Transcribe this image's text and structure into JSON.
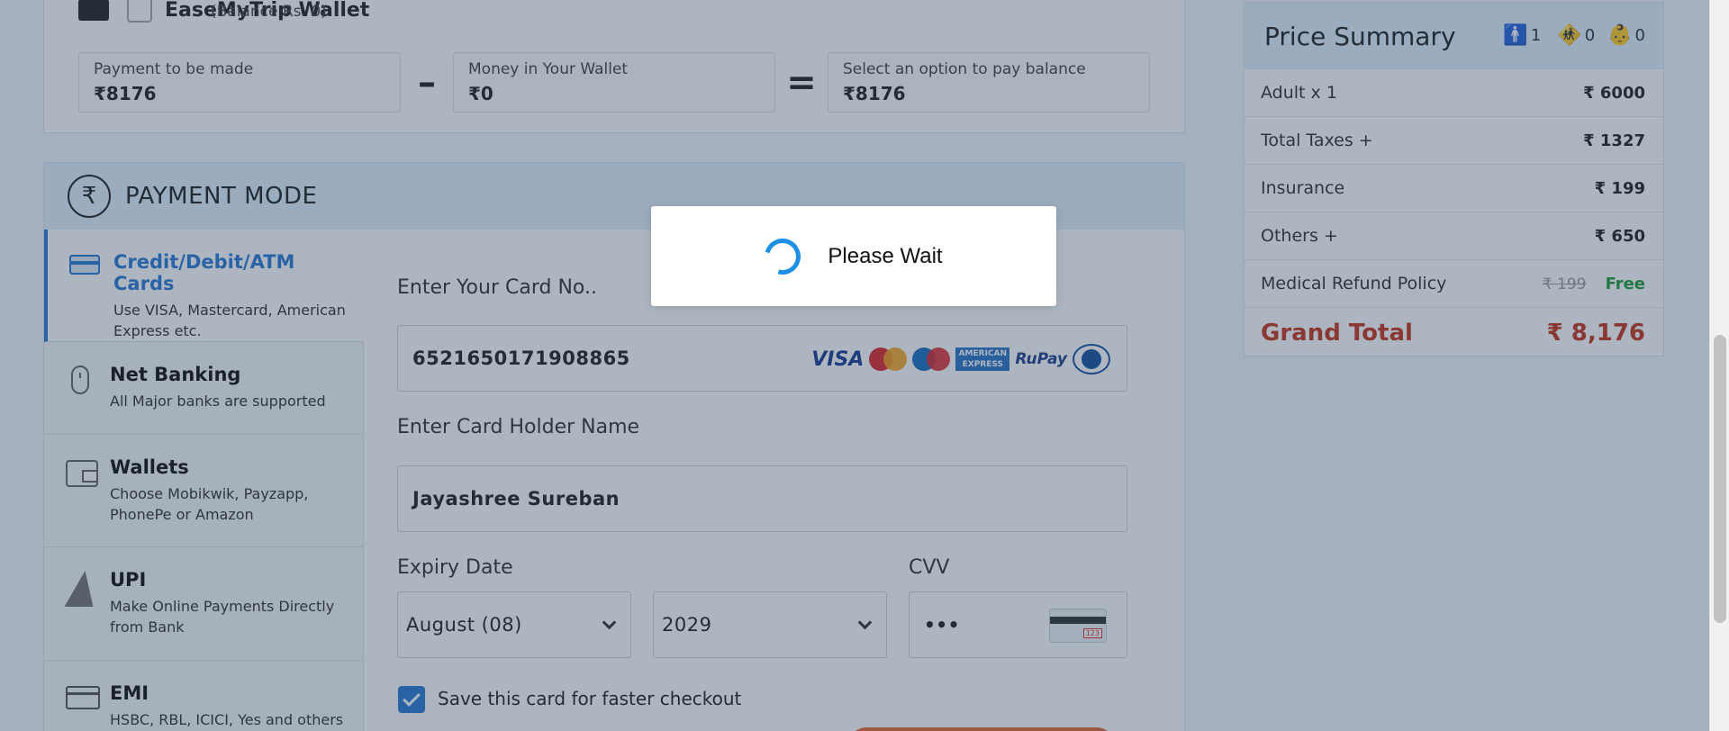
{
  "wallet": {
    "name": "EaseMyTrip Wallet",
    "balance": "(Balance Rs. 0)",
    "calc": [
      {
        "label": "Payment to be made",
        "value": "₹8176"
      },
      {
        "label": "Money in Your Wallet",
        "value": "₹0"
      },
      {
        "label": "Select an option to pay balance",
        "value": "₹8176"
      }
    ],
    "minus": "–",
    "equals": "="
  },
  "payment": {
    "title": "PAYMENT MODE",
    "currency_symbol": "₹",
    "modes": [
      {
        "title": "Credit/Debit/ATM Cards",
        "desc": "Use VISA, Mastercard, American Express etc.",
        "icon": "credit-card-icon",
        "active": true
      },
      {
        "title": "Net Banking",
        "desc": "All Major banks are supported",
        "icon": "mouse-icon",
        "active": false
      },
      {
        "title": "Wallets",
        "desc": "Choose Mobikwik, Payzapp, PhonePe or Amazon",
        "icon": "wallet-icon",
        "active": false
      },
      {
        "title": "UPI",
        "desc": "Make Online Payments Directly from Bank",
        "icon": "upi-icon",
        "active": false
      },
      {
        "title": "EMI",
        "desc": "HSBC, RBL, ICICI, Yes and others",
        "icon": "emi-card-icon",
        "active": false
      }
    ]
  },
  "form": {
    "card_label": "Enter Your Card No..",
    "card_number": "6521650171908865",
    "card_brands": {
      "visa": "VISA",
      "amex": "AMERICAN EXPRESS",
      "rupay": "RuPay"
    },
    "holder_label": "Enter Card Holder Name",
    "holder_name": "Jayashree Sureban",
    "expiry_label": "Expiry Date",
    "expiry_month": "August (08)",
    "expiry_year": "2029",
    "cvv_label": "CVV",
    "cvv_value": "•••",
    "save_card_label": "Save this card for faster checkout",
    "save_card_checked": true
  },
  "summary": {
    "title": "Price Summary",
    "pax": {
      "adults": "1",
      "children": "0",
      "infants": "0"
    },
    "rows": [
      {
        "label": "Adult x 1",
        "value": "₹ 6000"
      },
      {
        "label": "Total Taxes +",
        "value": "₹ 1327"
      },
      {
        "label": "Insurance",
        "value": "₹ 199"
      },
      {
        "label": "Others +",
        "value": "₹ 650"
      }
    ],
    "refund": {
      "label": "Medical Refund Policy",
      "original": "₹ 199",
      "value": "Free"
    },
    "grand_total_label": "Grand Total",
    "grand_total_value": "₹ 8,176"
  },
  "modal": {
    "text": "Please Wait"
  },
  "colors": {
    "accent": "#2a7ad5",
    "total": "#c7351c",
    "free": "#1e9b35",
    "spinner": "#1e8fe6"
  }
}
